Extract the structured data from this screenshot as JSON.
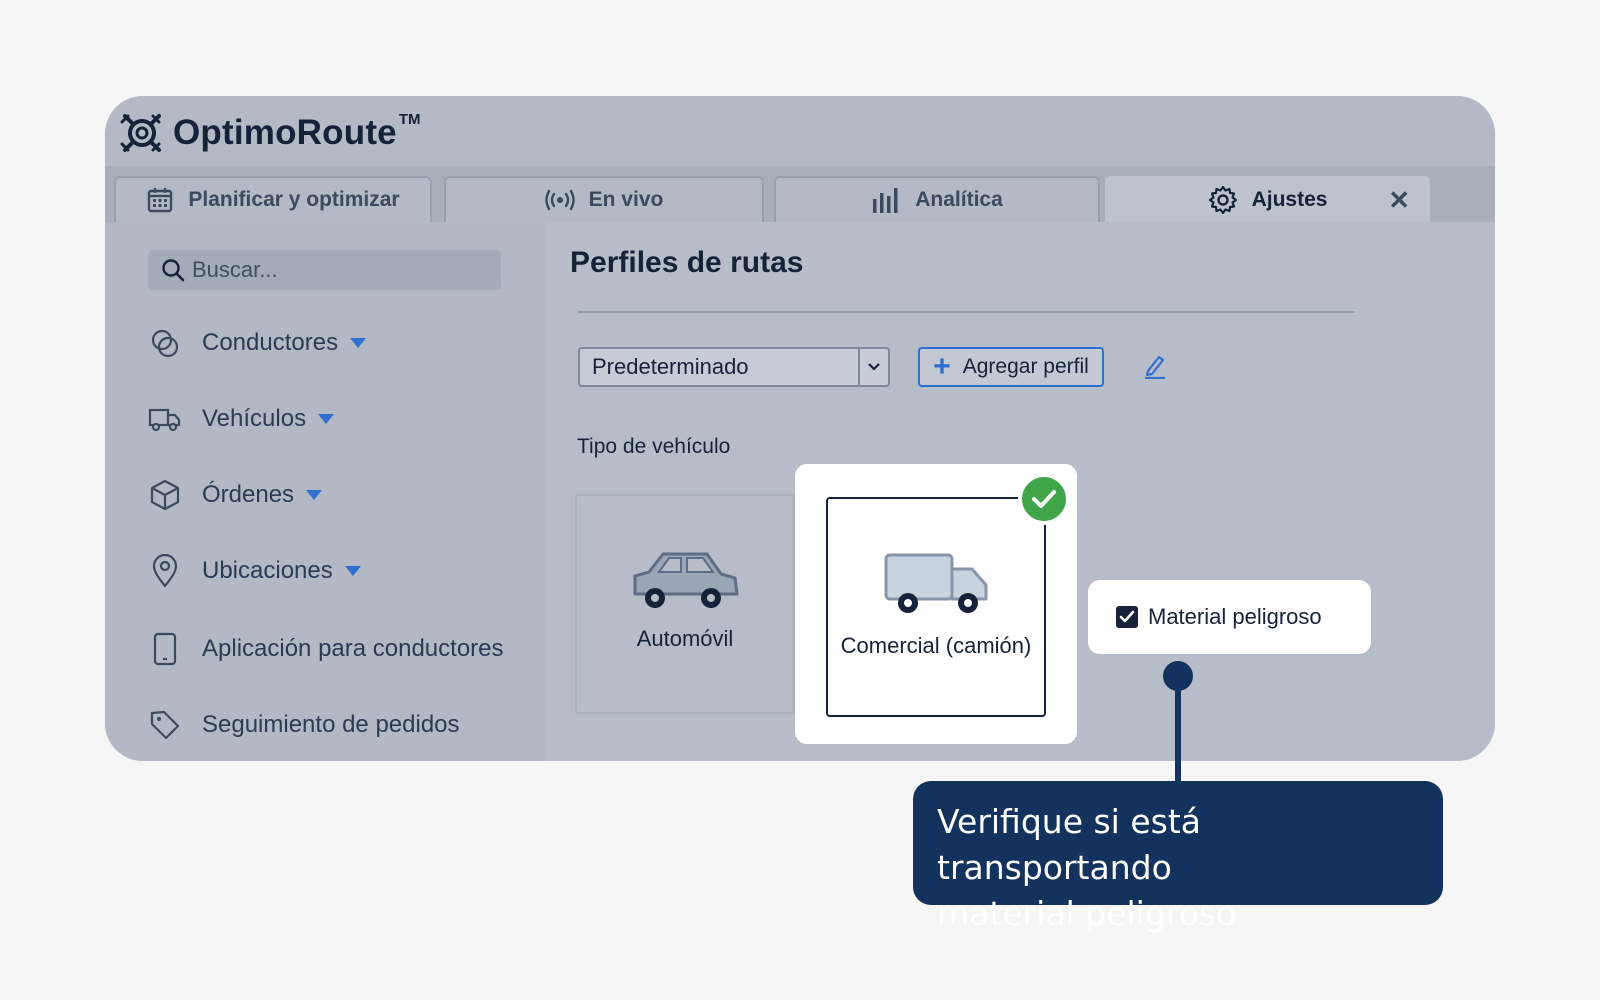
{
  "app": {
    "brand": "OptimoRoute",
    "brand_tm": "TM"
  },
  "tabs": [
    {
      "label": "Planificar y optimizar",
      "icon": "calendar-icon"
    },
    {
      "label": "En vivo",
      "icon": "broadcast-icon"
    },
    {
      "label": "Analítica",
      "icon": "bar-chart-icon"
    },
    {
      "label": "Ajustes",
      "icon": "gear-icon",
      "active": true
    }
  ],
  "sidebar": {
    "search_placeholder": "Buscar...",
    "items": [
      {
        "label": "Conductores",
        "icon": "driver-icon",
        "expandable": true
      },
      {
        "label": "Vehículos",
        "icon": "truck-icon",
        "expandable": true
      },
      {
        "label": "Órdenes",
        "icon": "package-icon",
        "expandable": true
      },
      {
        "label": "Ubicaciones",
        "icon": "map-pin-icon",
        "expandable": true
      },
      {
        "label": "Aplicación para conductores",
        "icon": "phone-icon",
        "expandable": false
      },
      {
        "label": "Seguimiento de pedidos",
        "icon": "tag-icon",
        "expandable": false
      }
    ]
  },
  "main": {
    "title": "Perfiles de rutas",
    "profile_select": "Predeterminado",
    "add_profile_label": "Agregar perfil",
    "vehicle_type_label": "Tipo de vehículo",
    "vehicle_types": [
      {
        "label": "Automóvil",
        "selected": false
      },
      {
        "label": "Comercial (camión)",
        "selected": true
      }
    ],
    "hazmat_label": "Material peligroso",
    "hazmat_checked": true
  },
  "callout": {
    "line1": "Verifique si está transportando",
    "line2": "material peligroso"
  },
  "colors": {
    "accent": "#2f6fd0",
    "success": "#3fa548",
    "callout_bg": "#13325e",
    "navy_text": "#15223a"
  }
}
